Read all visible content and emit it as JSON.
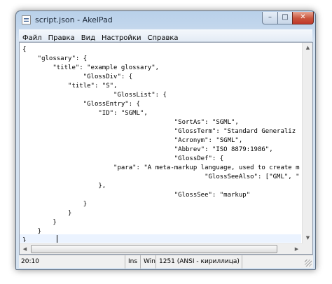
{
  "window": {
    "title": "script.json - AkelPad",
    "min_glyph": "–",
    "max_glyph": "□",
    "close_glyph": "✕"
  },
  "menu": [
    {
      "label": "Файл"
    },
    {
      "label": "Правка"
    },
    {
      "label": "Вид"
    },
    {
      "label": "Настройки"
    },
    {
      "label": "Справка"
    }
  ],
  "editor": {
    "lines": [
      "{",
      "    \"glossary\": {",
      "        \"title\": \"example glossary\",",
      "                \"GlossDiv\": {",
      "            \"title\": \"S\",",
      "                        \"GlossList\": {",
      "                \"GlossEntry\": {",
      "                    \"ID\": \"SGML\",",
      "                                        \"SortAs\": \"SGML\",",
      "                                        \"GlossTerm\": \"Standard Generaliz",
      "                                        \"Acronym\": \"SGML\",",
      "                                        \"Abbrev\": \"ISO 8879:1986\",",
      "                                        \"GlossDef\": {",
      "                        \"para\": \"A meta-markup language, used to create m",
      "                                                \"GlossSeeAlso\": [\"GML\", \"",
      "                    },",
      "                                        \"GlossSee\": \"markup\"",
      "                }",
      "            }",
      "        }",
      "    }",
      "}"
    ]
  },
  "scrollbars": {
    "up": "▲",
    "down": "▼",
    "left": "◀",
    "right": "▶"
  },
  "statusbar": {
    "position": "20:10",
    "mode": "Ins",
    "eol": "Win",
    "encoding": "1251  (ANSI - кириллица)"
  },
  "colors": {
    "titlebar": "#b9d1ea",
    "editor_bg": "#ffffff",
    "current_line": "#ebf3ff",
    "close_button": "#c9543c"
  }
}
